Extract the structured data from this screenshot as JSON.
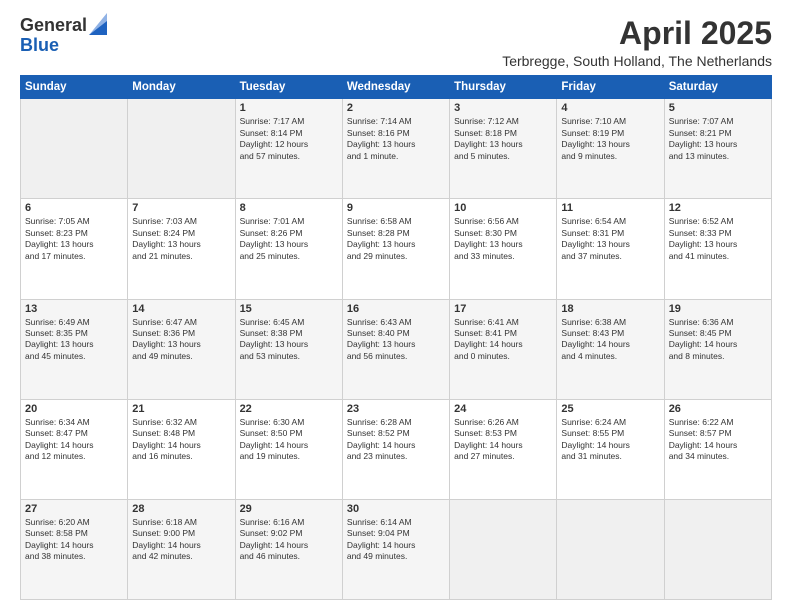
{
  "logo": {
    "general": "General",
    "blue": "Blue"
  },
  "title": "April 2025",
  "location": "Terbregge, South Holland, The Netherlands",
  "weekdays": [
    "Sunday",
    "Monday",
    "Tuesday",
    "Wednesday",
    "Thursday",
    "Friday",
    "Saturday"
  ],
  "weeks": [
    [
      {
        "day": "",
        "info": "",
        "empty": true
      },
      {
        "day": "",
        "info": "",
        "empty": true
      },
      {
        "day": "1",
        "info": "Sunrise: 7:17 AM\nSunset: 8:14 PM\nDaylight: 12 hours\nand 57 minutes."
      },
      {
        "day": "2",
        "info": "Sunrise: 7:14 AM\nSunset: 8:16 PM\nDaylight: 13 hours\nand 1 minute."
      },
      {
        "day": "3",
        "info": "Sunrise: 7:12 AM\nSunset: 8:18 PM\nDaylight: 13 hours\nand 5 minutes."
      },
      {
        "day": "4",
        "info": "Sunrise: 7:10 AM\nSunset: 8:19 PM\nDaylight: 13 hours\nand 9 minutes."
      },
      {
        "day": "5",
        "info": "Sunrise: 7:07 AM\nSunset: 8:21 PM\nDaylight: 13 hours\nand 13 minutes."
      }
    ],
    [
      {
        "day": "6",
        "info": "Sunrise: 7:05 AM\nSunset: 8:23 PM\nDaylight: 13 hours\nand 17 minutes."
      },
      {
        "day": "7",
        "info": "Sunrise: 7:03 AM\nSunset: 8:24 PM\nDaylight: 13 hours\nand 21 minutes."
      },
      {
        "day": "8",
        "info": "Sunrise: 7:01 AM\nSunset: 8:26 PM\nDaylight: 13 hours\nand 25 minutes."
      },
      {
        "day": "9",
        "info": "Sunrise: 6:58 AM\nSunset: 8:28 PM\nDaylight: 13 hours\nand 29 minutes."
      },
      {
        "day": "10",
        "info": "Sunrise: 6:56 AM\nSunset: 8:30 PM\nDaylight: 13 hours\nand 33 minutes."
      },
      {
        "day": "11",
        "info": "Sunrise: 6:54 AM\nSunset: 8:31 PM\nDaylight: 13 hours\nand 37 minutes."
      },
      {
        "day": "12",
        "info": "Sunrise: 6:52 AM\nSunset: 8:33 PM\nDaylight: 13 hours\nand 41 minutes."
      }
    ],
    [
      {
        "day": "13",
        "info": "Sunrise: 6:49 AM\nSunset: 8:35 PM\nDaylight: 13 hours\nand 45 minutes."
      },
      {
        "day": "14",
        "info": "Sunrise: 6:47 AM\nSunset: 8:36 PM\nDaylight: 13 hours\nand 49 minutes."
      },
      {
        "day": "15",
        "info": "Sunrise: 6:45 AM\nSunset: 8:38 PM\nDaylight: 13 hours\nand 53 minutes."
      },
      {
        "day": "16",
        "info": "Sunrise: 6:43 AM\nSunset: 8:40 PM\nDaylight: 13 hours\nand 56 minutes."
      },
      {
        "day": "17",
        "info": "Sunrise: 6:41 AM\nSunset: 8:41 PM\nDaylight: 14 hours\nand 0 minutes."
      },
      {
        "day": "18",
        "info": "Sunrise: 6:38 AM\nSunset: 8:43 PM\nDaylight: 14 hours\nand 4 minutes."
      },
      {
        "day": "19",
        "info": "Sunrise: 6:36 AM\nSunset: 8:45 PM\nDaylight: 14 hours\nand 8 minutes."
      }
    ],
    [
      {
        "day": "20",
        "info": "Sunrise: 6:34 AM\nSunset: 8:47 PM\nDaylight: 14 hours\nand 12 minutes."
      },
      {
        "day": "21",
        "info": "Sunrise: 6:32 AM\nSunset: 8:48 PM\nDaylight: 14 hours\nand 16 minutes."
      },
      {
        "day": "22",
        "info": "Sunrise: 6:30 AM\nSunset: 8:50 PM\nDaylight: 14 hours\nand 19 minutes."
      },
      {
        "day": "23",
        "info": "Sunrise: 6:28 AM\nSunset: 8:52 PM\nDaylight: 14 hours\nand 23 minutes."
      },
      {
        "day": "24",
        "info": "Sunrise: 6:26 AM\nSunset: 8:53 PM\nDaylight: 14 hours\nand 27 minutes."
      },
      {
        "day": "25",
        "info": "Sunrise: 6:24 AM\nSunset: 8:55 PM\nDaylight: 14 hours\nand 31 minutes."
      },
      {
        "day": "26",
        "info": "Sunrise: 6:22 AM\nSunset: 8:57 PM\nDaylight: 14 hours\nand 34 minutes."
      }
    ],
    [
      {
        "day": "27",
        "info": "Sunrise: 6:20 AM\nSunset: 8:58 PM\nDaylight: 14 hours\nand 38 minutes."
      },
      {
        "day": "28",
        "info": "Sunrise: 6:18 AM\nSunset: 9:00 PM\nDaylight: 14 hours\nand 42 minutes."
      },
      {
        "day": "29",
        "info": "Sunrise: 6:16 AM\nSunset: 9:02 PM\nDaylight: 14 hours\nand 46 minutes."
      },
      {
        "day": "30",
        "info": "Sunrise: 6:14 AM\nSunset: 9:04 PM\nDaylight: 14 hours\nand 49 minutes."
      },
      {
        "day": "",
        "info": "",
        "empty": true
      },
      {
        "day": "",
        "info": "",
        "empty": true
      },
      {
        "day": "",
        "info": "",
        "empty": true
      }
    ]
  ]
}
